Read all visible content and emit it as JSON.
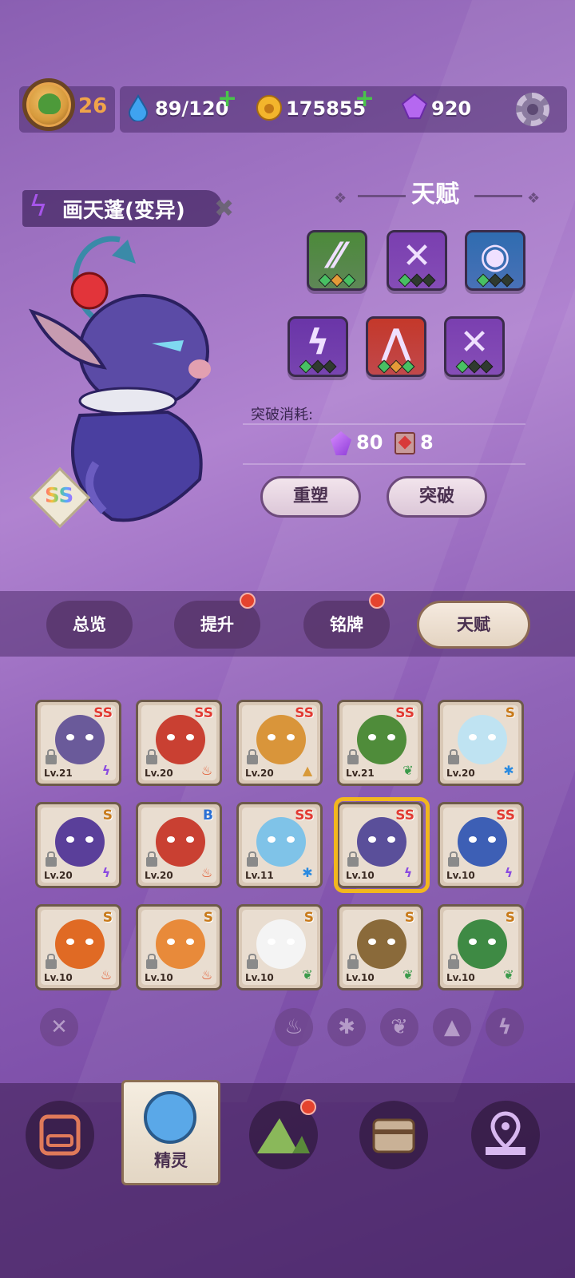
{
  "header": {
    "player_level": "26",
    "stamina": "89/120",
    "coins": "175855",
    "gems": "920"
  },
  "pet": {
    "name": "画天蓬(变异)",
    "grade": "SS"
  },
  "talent": {
    "title": "天赋",
    "tiles": [
      {
        "name": "claw",
        "color": "#4c8a3a",
        "glyph": "⁄⁄"
      },
      {
        "name": "wind",
        "color": "#7a3fb0",
        "glyph": "✕"
      },
      {
        "name": "eye",
        "color": "#2f6cb0",
        "glyph": "◉"
      },
      {
        "name": "lightning",
        "color": "#6a35a8",
        "glyph": "ϟ"
      },
      {
        "name": "fang",
        "color": "#c4382a",
        "glyph": "⋀"
      },
      {
        "name": "wind",
        "color": "#7a3fb0",
        "glyph": "✕"
      }
    ],
    "cost_label": "突破消耗:",
    "cost_crystal": "80",
    "cost_card": "8",
    "btn_reshape": "重塑",
    "btn_breakthrough": "突破"
  },
  "tabs": [
    "总览",
    "提升",
    "铭牌",
    "天赋"
  ],
  "pets": [
    {
      "lv": "Lv.21",
      "grade": "SS",
      "elem": "lightning",
      "color": "#6a5a9a"
    },
    {
      "lv": "Lv.20",
      "grade": "SS",
      "elem": "fire",
      "color": "#c94032"
    },
    {
      "lv": "Lv.20",
      "grade": "SS",
      "elem": "earth",
      "color": "#d9953a"
    },
    {
      "lv": "Lv.21",
      "grade": "SS",
      "elem": "grass",
      "color": "#4f8c3a"
    },
    {
      "lv": "Lv.20",
      "grade": "S",
      "elem": "ice",
      "color": "#bfe3f2"
    },
    {
      "lv": "Lv.20",
      "grade": "S",
      "elem": "lightning",
      "color": "#5a3f9a"
    },
    {
      "lv": "Lv.20",
      "grade": "B",
      "elem": "fire",
      "color": "#c94032"
    },
    {
      "lv": "Lv.11",
      "grade": "SS",
      "elem": "ice",
      "color": "#7fc3e8"
    },
    {
      "lv": "Lv.10",
      "grade": "SS",
      "elem": "lightning",
      "color": "#5a4f9a"
    },
    {
      "lv": "Lv.10",
      "grade": "SS",
      "elem": "lightning",
      "color": "#3d5fb5"
    },
    {
      "lv": "Lv.10",
      "grade": "S",
      "elem": "fire",
      "color": "#e06a24"
    },
    {
      "lv": "Lv.10",
      "grade": "S",
      "elem": "fire",
      "color": "#e88a3a"
    },
    {
      "lv": "Lv.10",
      "grade": "S",
      "elem": "grass",
      "color": "#f4f4f4"
    },
    {
      "lv": "Lv.10",
      "grade": "S",
      "elem": "grass",
      "color": "#8a6a3a"
    },
    {
      "lv": "Lv.10",
      "grade": "S",
      "elem": "grass",
      "color": "#3e8a44"
    }
  ],
  "filters": [
    "clear",
    "fire",
    "ice",
    "grass",
    "earth",
    "lightning"
  ],
  "nav": {
    "items": [
      "device",
      "spirit",
      "mountain",
      "chest",
      "map-pin"
    ],
    "selected_label": "精灵"
  }
}
